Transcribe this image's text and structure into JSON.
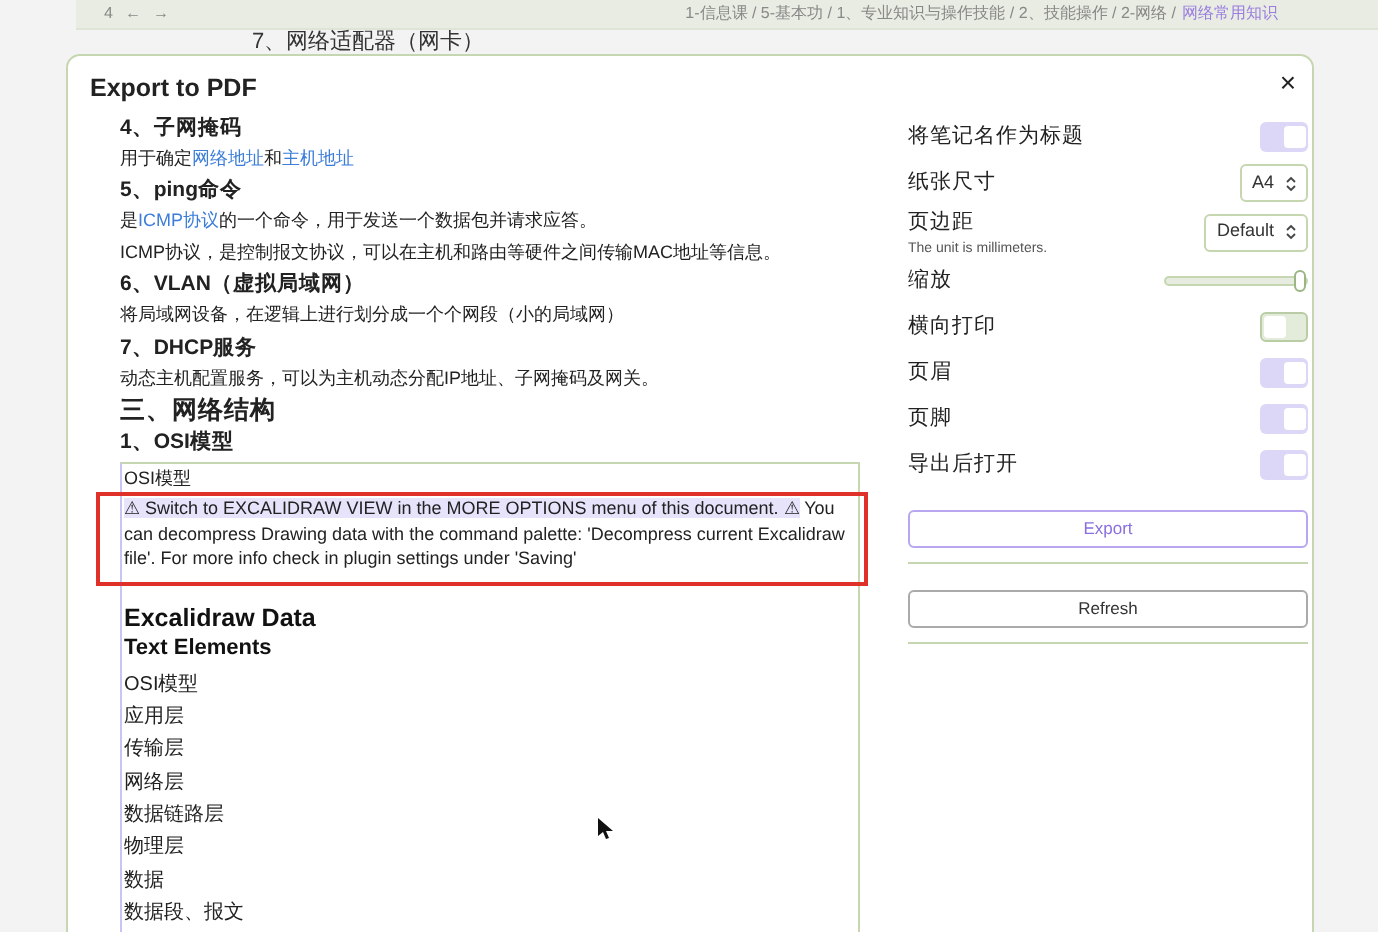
{
  "nav": {
    "page": "4",
    "back": "←",
    "forward": "→"
  },
  "breadcrumb": {
    "path": "1-信息课 / 5-基本功 / 1、专业知识与操作技能 / 2、技能操作 / 2-网络 /",
    "current": "网络常用知识"
  },
  "background_heading": "7、网络适配器（网卡）",
  "dialog": {
    "title": "Export to PDF",
    "close": "×"
  },
  "preview": [
    {
      "kind": "heading",
      "text": "4、子网掩码"
    },
    {
      "kind": "paragraph",
      "parts": [
        {
          "kind": "text",
          "text": "用于确定"
        },
        {
          "kind": "link",
          "text": "网络地址"
        },
        {
          "kind": "text",
          "text": "和"
        },
        {
          "kind": "link",
          "text": "主机地址"
        }
      ]
    },
    {
      "kind": "heading",
      "text": "5、ping命令"
    },
    {
      "kind": "paragraph",
      "parts": [
        {
          "kind": "text",
          "text": "是"
        },
        {
          "kind": "link",
          "text": "ICMP协议"
        },
        {
          "kind": "text",
          "text": "的一个命令，用于发送一个数据包并请求应答。"
        }
      ]
    },
    {
      "kind": "paragraph",
      "parts": [
        {
          "kind": "text",
          "text": "ICMP协议，是控制报文协议，可以在主机和路由等硬件之间传输MAC地址等信息。"
        }
      ]
    },
    {
      "kind": "heading",
      "text": "6、VLAN（虚拟局域网）"
    },
    {
      "kind": "paragraph",
      "parts": [
        {
          "kind": "text",
          "text": "将局域网设备，在逻辑上进行划分成一个个网段（小的局域网）"
        }
      ]
    },
    {
      "kind": "heading",
      "text": "7、DHCP服务"
    },
    {
      "kind": "paragraph",
      "parts": [
        {
          "kind": "text",
          "text": "动态主机配置服务，可以为主机动态分配IP地址、子网掩码及网关。"
        }
      ]
    },
    {
      "kind": "section",
      "text": "三、网络结构"
    },
    {
      "kind": "heading",
      "text": "1、OSI模型"
    }
  ],
  "embed": {
    "caption": "OSI模型",
    "warning": {
      "highlighted": "⚠ Switch to EXCALIDRAW VIEW in the MORE OPTIONS menu of this document. ⚠",
      "rest": "You can decompress Drawing data with the command palette: 'Decompress current Excalidraw file'. For more info check in plugin settings under 'Saving'"
    },
    "title": "Excalidraw Data",
    "subtitle": "Text Elements",
    "items": [
      "OSI模型",
      "应用层",
      "传输层",
      "网络层",
      "数据链路层",
      "物理层",
      "数据",
      "数据段、报文"
    ]
  },
  "settings": [
    {
      "kind": "toggle",
      "label": "将笔记名作为标题",
      "on": true
    },
    {
      "kind": "select",
      "label": "纸张尺寸",
      "value": "A4"
    },
    {
      "kind": "select",
      "label": "页边距",
      "hint": "The unit is millimeters.",
      "value": "Default"
    },
    {
      "kind": "slider",
      "label": "缩放",
      "level": 1.0
    },
    {
      "kind": "toggle",
      "label": "横向打印",
      "on": false
    },
    {
      "kind": "toggle",
      "label": "页眉",
      "on": true
    },
    {
      "kind": "toggle",
      "label": "页脚",
      "on": true
    },
    {
      "kind": "toggle",
      "label": "导出后打开",
      "on": true
    }
  ],
  "buttons": [
    {
      "label": "Export",
      "primary": true
    },
    {
      "label": "Refresh",
      "primary": false
    }
  ]
}
